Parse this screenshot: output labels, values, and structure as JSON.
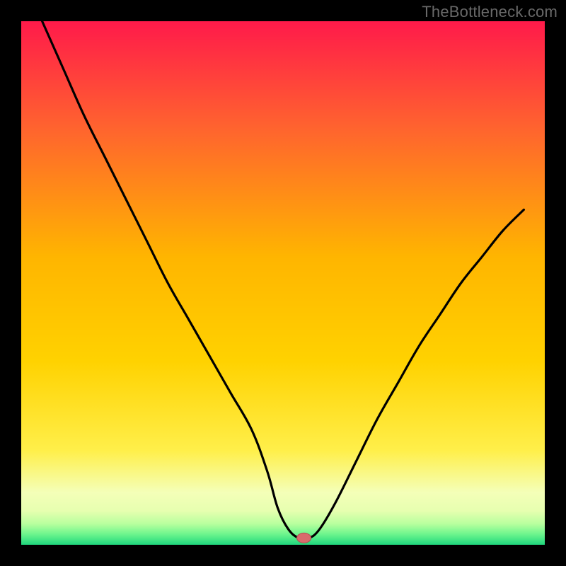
{
  "watermark": "TheBottleneck.com",
  "chart_data": {
    "type": "line",
    "title": "",
    "xlabel": "",
    "ylabel": "",
    "xlim": [
      0,
      100
    ],
    "ylim": [
      0,
      100
    ],
    "note": "Axes are unlabeled in the image; x/y are normalized 0–100. Curve values are read from the picture.",
    "x": [
      4,
      8,
      12,
      16,
      20,
      24,
      28,
      32,
      36,
      40,
      44,
      47,
      49,
      51,
      53,
      55,
      57,
      60,
      64,
      68,
      72,
      76,
      80,
      84,
      88,
      92,
      96
    ],
    "values": [
      100,
      91,
      82,
      74,
      66,
      58,
      50,
      43,
      36,
      29,
      22,
      14,
      7,
      3,
      1.3,
      1.3,
      3,
      8,
      16,
      24,
      31,
      38,
      44,
      50,
      55,
      60,
      64
    ],
    "marker": {
      "x": 54,
      "y": 1.3
    },
    "bands": [
      {
        "name": "green",
        "y0": 0,
        "y1": 2.8
      },
      {
        "name": "light-green",
        "y0": 2.8,
        "y1": 4.8
      },
      {
        "name": "pale-green",
        "y0": 4.8,
        "y1": 7.2
      },
      {
        "name": "yellow-green",
        "y0": 7.2,
        "y1": 12
      }
    ]
  },
  "colors": {
    "black": "#000000",
    "curve": "#000000",
    "marker_fill": "#da6a6c",
    "marker_stroke": "#b64f52",
    "grad_top": "#ff1a4a",
    "grad_upper": "#ff622f",
    "grad_mid": "#ffd200",
    "grad_lower": "#fff27a",
    "grad_pale": "#f4ffb8",
    "grad_band1": "#b8ff9e",
    "grad_band2": "#6cf58d",
    "grad_bottom": "#1fd67d"
  },
  "layout": {
    "margin_left": 30,
    "margin_right": 30,
    "margin_top": 30,
    "margin_bottom": 30
  }
}
